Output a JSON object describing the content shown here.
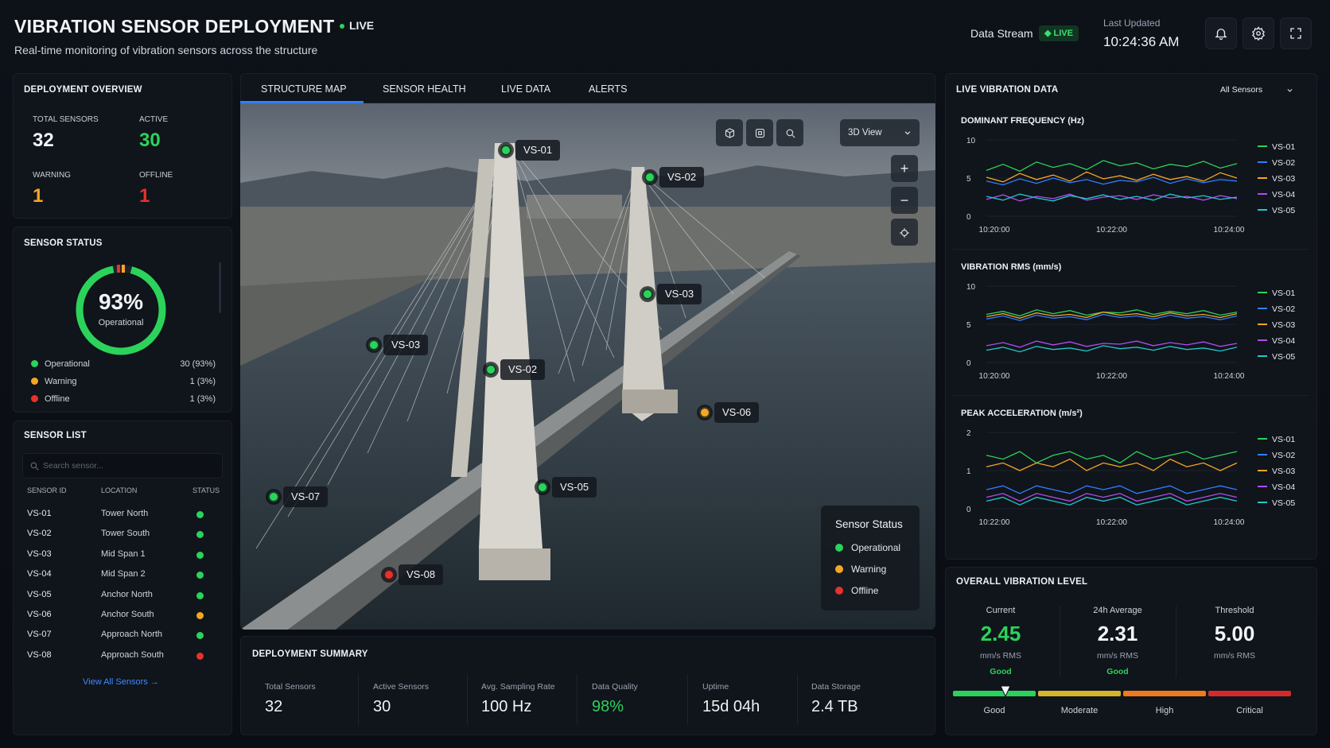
{
  "header": {
    "title": "VIBRATION SENSOR DEPLOYMENT",
    "live": "LIVE",
    "subtitle": "Real-time monitoring of vibration sensors across the structure",
    "data_stream_label": "Data Stream",
    "data_stream_badge": "LIVE",
    "last_updated_label": "Last Updated",
    "last_updated_time": "10:24:36 AM",
    "icons": [
      "bell-icon",
      "gear-icon",
      "fullscreen-icon"
    ]
  },
  "overview": {
    "title": "DEPLOYMENT OVERVIEW",
    "total_label": "TOTAL SENSORS",
    "total_value": "32",
    "active_label": "ACTIVE",
    "active_value": "30",
    "warning_label": "WARNING",
    "warning_value": "1",
    "offline_label": "OFFLINE",
    "offline_value": "1"
  },
  "sensor_status": {
    "title": "SENSOR STATUS",
    "percent": "93%",
    "percent_label": "Operational",
    "operational_fraction": 0.93,
    "items": [
      {
        "label": "Operational",
        "count": "30 (93%)",
        "color": "#2bd35a"
      },
      {
        "label": "Warning",
        "count": "1 (3%)",
        "color": "#f5a623"
      },
      {
        "label": "Offline",
        "count": "1 (3%)",
        "color": "#e5322d"
      }
    ]
  },
  "sensor_list": {
    "title": "SENSOR LIST",
    "search_placeholder": "Search sensor...",
    "columns": [
      "SENSOR ID",
      "LOCATION",
      "STATUS"
    ],
    "rows": [
      {
        "id": "VS-01",
        "location": "Tower North",
        "status_color": "#2bd35a"
      },
      {
        "id": "VS-02",
        "location": "Tower South",
        "status_color": "#2bd35a"
      },
      {
        "id": "VS-03",
        "location": "Mid Span 1",
        "status_color": "#2bd35a"
      },
      {
        "id": "VS-04",
        "location": "Mid Span 2",
        "status_color": "#2bd35a"
      },
      {
        "id": "VS-05",
        "location": "Anchor North",
        "status_color": "#2bd35a"
      },
      {
        "id": "VS-06",
        "location": "Anchor South",
        "status_color": "#f5a623"
      },
      {
        "id": "VS-07",
        "location": "Approach North",
        "status_color": "#2bd35a"
      },
      {
        "id": "VS-08",
        "location": "Approach South",
        "status_color": "#e5322d"
      }
    ],
    "view_all": "View All Sensors →"
  },
  "tabs": [
    "STRUCTURE MAP",
    "SENSOR HEALTH",
    "LIVE DATA",
    "ALERTS"
  ],
  "map": {
    "view_select": "3D View",
    "markers": [
      {
        "label": "VS-01",
        "color": "#2bd35a"
      },
      {
        "label": "VS-02",
        "color": "#2bd35a"
      },
      {
        "label": "VS-03",
        "color": "#2bd35a"
      },
      {
        "label": "VS-03",
        "color": "#2bd35a"
      },
      {
        "label": "VS-02",
        "color": "#2bd35a"
      },
      {
        "label": "VS-06",
        "color": "#f5a623"
      },
      {
        "label": "VS-05",
        "color": "#2bd35a"
      },
      {
        "label": "VS-07",
        "color": "#2bd35a"
      },
      {
        "label": "VS-08",
        "color": "#e5322d"
      }
    ],
    "legend_title": "Sensor Status",
    "legend": [
      {
        "label": "Operational",
        "color": "#2bd35a"
      },
      {
        "label": "Warning",
        "color": "#f5a623"
      },
      {
        "label": "Offline",
        "color": "#e5322d"
      }
    ]
  },
  "summary": {
    "title": "DEPLOYMENT SUMMARY",
    "items": [
      {
        "label": "Total Sensors",
        "value": "32"
      },
      {
        "label": "Active Sensors",
        "value": "30"
      },
      {
        "label": "Avg. Sampling Rate",
        "value": "100 Hz"
      },
      {
        "label": "Data Quality",
        "value": "98%"
      },
      {
        "label": "Uptime",
        "value": "15d 04h"
      },
      {
        "label": "Data Storage",
        "value": "2.4 TB"
      }
    ]
  },
  "live_data": {
    "title": "LIVE VIBRATION DATA",
    "filter": "All Sensors",
    "series_colors": [
      "#2bd35a",
      "#2f80ff",
      "#f5a623",
      "#b04cf0",
      "#22c9c9"
    ]
  },
  "chart_data": [
    {
      "type": "line",
      "title": "DOMINANT FREQUENCY (Hz)",
      "x": [
        "10:20:00",
        "10:22:00",
        "10:24:00"
      ],
      "ylim": [
        0,
        10
      ],
      "yticks": [
        "10",
        "5",
        "0"
      ],
      "series": [
        {
          "name": "VS-01",
          "values": [
            6.0,
            6.8,
            5.9,
            7.1,
            6.4,
            6.9,
            6.1,
            7.3,
            6.6,
            7.0,
            6.2,
            6.8,
            6.5,
            7.2,
            6.3,
            6.9
          ]
        },
        {
          "name": "VS-02",
          "values": [
            4.6,
            4.1,
            4.9,
            4.3,
            5.0,
            4.4,
            4.8,
            4.2,
            4.7,
            4.5,
            5.1,
            4.3,
            4.9,
            4.4,
            4.8,
            4.6
          ]
        },
        {
          "name": "VS-03",
          "values": [
            5.1,
            4.5,
            5.6,
            4.8,
            5.4,
            4.6,
            5.8,
            4.9,
            5.3,
            4.7,
            5.5,
            4.8,
            5.2,
            4.6,
            5.7,
            5.0
          ]
        },
        {
          "name": "VS-04",
          "values": [
            2.2,
            2.8,
            2.0,
            2.6,
            2.3,
            2.9,
            2.1,
            2.5,
            2.7,
            2.2,
            2.8,
            2.4,
            2.6,
            2.1,
            2.7,
            2.3
          ]
        },
        {
          "name": "VS-05",
          "values": [
            2.6,
            2.1,
            2.9,
            2.4,
            2.0,
            2.7,
            2.3,
            2.8,
            2.2,
            2.6,
            2.1,
            2.9,
            2.4,
            2.7,
            2.2,
            2.5
          ]
        }
      ]
    },
    {
      "type": "line",
      "title": "VIBRATION RMS (mm/s)",
      "x": [
        "10:20:00",
        "10:22:00",
        "10:24:00"
      ],
      "ylim": [
        0,
        10
      ],
      "yticks": [
        "10",
        "5",
        "0"
      ],
      "series": [
        {
          "name": "VS-01",
          "values": [
            6.3,
            6.7,
            6.1,
            6.9,
            6.4,
            6.8,
            6.2,
            6.6,
            6.5,
            6.9,
            6.3,
            6.7,
            6.4,
            6.8,
            6.2,
            6.6
          ]
        },
        {
          "name": "VS-02",
          "values": [
            5.7,
            6.1,
            5.5,
            6.2,
            5.8,
            6.0,
            5.6,
            6.3,
            5.9,
            6.1,
            5.7,
            6.2,
            5.8,
            6.0,
            5.6,
            6.1
          ]
        },
        {
          "name": "VS-03",
          "values": [
            6.0,
            6.4,
            5.8,
            6.5,
            6.1,
            6.3,
            5.9,
            6.6,
            6.2,
            6.4,
            6.0,
            6.5,
            6.1,
            6.3,
            5.9,
            6.4
          ]
        },
        {
          "name": "VS-04",
          "values": [
            2.2,
            2.6,
            2.0,
            2.8,
            2.3,
            2.7,
            2.1,
            2.5,
            2.4,
            2.8,
            2.2,
            2.6,
            2.3,
            2.7,
            2.1,
            2.5
          ]
        },
        {
          "name": "VS-05",
          "values": [
            1.6,
            2.0,
            1.4,
            2.1,
            1.7,
            1.9,
            1.5,
            2.2,
            1.8,
            2.0,
            1.6,
            2.1,
            1.7,
            1.9,
            1.5,
            2.0
          ]
        }
      ]
    },
    {
      "type": "line",
      "title": "PEAK ACCELERATION (m/s²)",
      "x": [
        "10:22:00",
        "10:22:00",
        "10:24:00"
      ],
      "ylim": [
        0,
        2
      ],
      "yticks": [
        "2",
        "1",
        "0"
      ],
      "series": [
        {
          "name": "VS-01",
          "values": [
            1.4,
            1.3,
            1.5,
            1.2,
            1.4,
            1.5,
            1.3,
            1.4,
            1.2,
            1.5,
            1.3,
            1.4,
            1.5,
            1.3,
            1.4,
            1.5
          ]
        },
        {
          "name": "VS-02",
          "values": [
            0.5,
            0.6,
            0.4,
            0.6,
            0.5,
            0.4,
            0.6,
            0.5,
            0.6,
            0.4,
            0.5,
            0.6,
            0.4,
            0.5,
            0.6,
            0.5
          ]
        },
        {
          "name": "VS-03",
          "values": [
            1.1,
            1.2,
            1.0,
            1.2,
            1.1,
            1.3,
            1.0,
            1.2,
            1.1,
            1.2,
            1.0,
            1.3,
            1.1,
            1.2,
            1.0,
            1.2
          ]
        },
        {
          "name": "VS-04",
          "values": [
            0.3,
            0.4,
            0.2,
            0.4,
            0.3,
            0.2,
            0.4,
            0.3,
            0.4,
            0.2,
            0.3,
            0.4,
            0.2,
            0.3,
            0.4,
            0.3
          ]
        },
        {
          "name": "VS-05",
          "values": [
            0.2,
            0.3,
            0.1,
            0.3,
            0.2,
            0.1,
            0.3,
            0.2,
            0.3,
            0.1,
            0.2,
            0.3,
            0.1,
            0.2,
            0.3,
            0.2
          ]
        }
      ]
    }
  ],
  "overall": {
    "title": "OVERALL VIBRATION LEVEL",
    "current_label": "Current",
    "current_value": "2.45",
    "current_unit": "mm/s RMS",
    "current_status": "Good",
    "avg_label": "24h Average",
    "avg_value": "2.31",
    "avg_unit": "mm/s RMS",
    "avg_status": "Good",
    "threshold_label": "Threshold",
    "threshold_value": "5.00",
    "threshold_unit": "mm/s RMS",
    "scale": [
      "Good",
      "Moderate",
      "High",
      "Critical"
    ],
    "scale_colors": [
      "#2bd35a",
      "#d4b629",
      "#f07a1f",
      "#d42a2a"
    ],
    "level_fraction": 0.155
  }
}
